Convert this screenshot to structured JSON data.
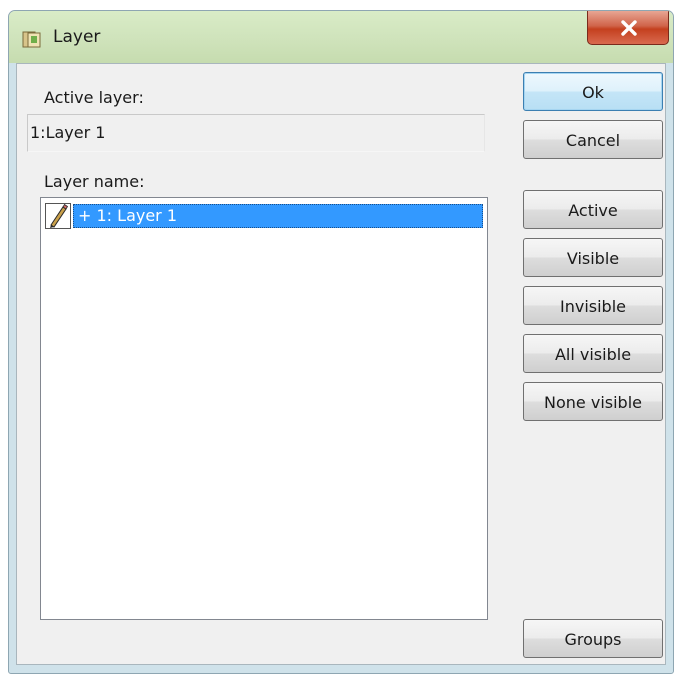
{
  "window": {
    "title": "Layer"
  },
  "labels": {
    "active_layer": "Active layer:",
    "layer_name": "Layer name:"
  },
  "active_layer_value": "1:Layer 1",
  "layers": [
    {
      "label": "+ 1: Layer 1",
      "selected": true,
      "icon": "pencil-icon"
    }
  ],
  "buttons": {
    "ok": "Ok",
    "cancel": "Cancel",
    "active": "Active",
    "visible": "Visible",
    "invisible": "Invisible",
    "all_visible": "All visible",
    "none_visible": "None visible",
    "groups": "Groups"
  },
  "colors": {
    "selection": "#3399ff",
    "close_button": "#c4401f",
    "default_button": "#3c7fb1"
  }
}
